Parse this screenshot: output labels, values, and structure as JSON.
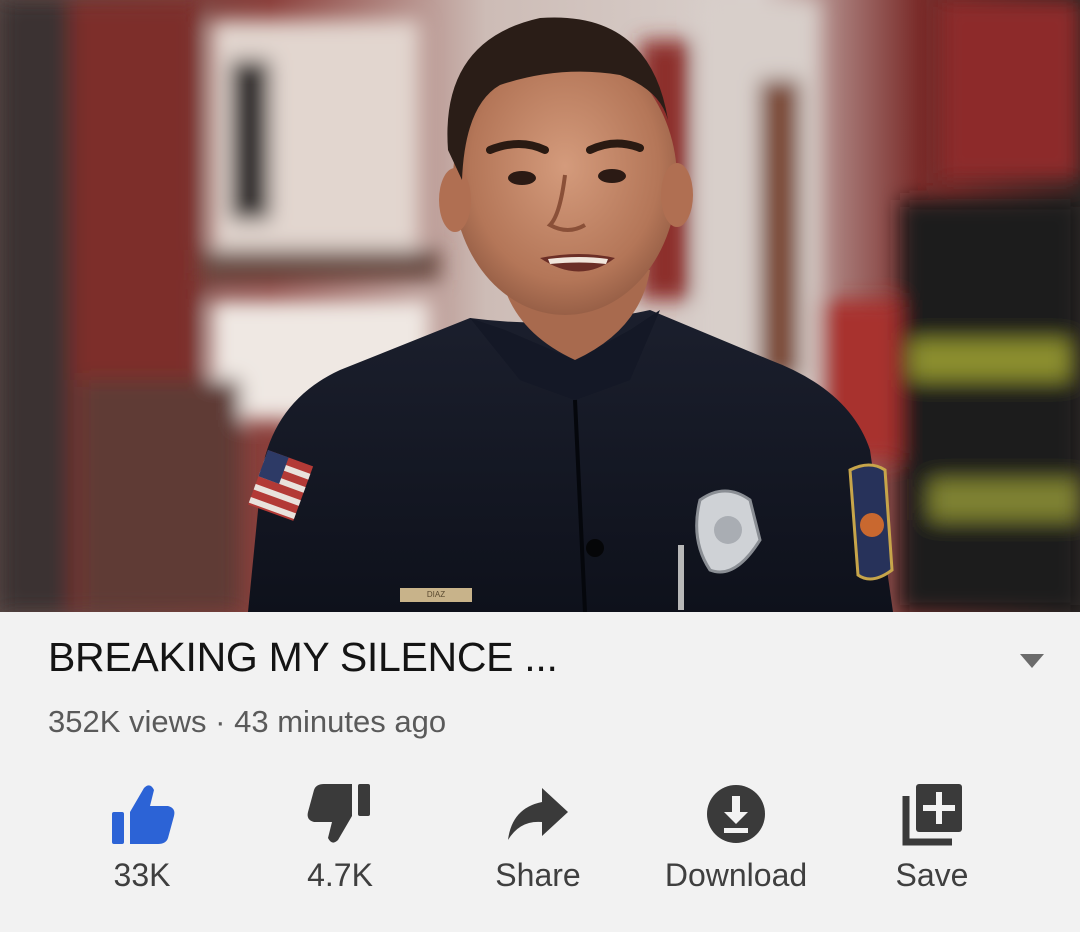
{
  "video": {
    "description_icon": "firefighter-portrait-image"
  },
  "details": {
    "title": "BREAKING MY SILENCE ...",
    "views": "352K views",
    "separator": "·",
    "uploaded": "43 minutes ago",
    "expand_icon": "chevron-down-icon"
  },
  "actions": {
    "like": {
      "label": "33K",
      "icon": "thumbs-up-icon",
      "color": "#2c63d6"
    },
    "dislike": {
      "label": "4.7K",
      "icon": "thumbs-down-icon",
      "color": "#3a3a3a"
    },
    "share": {
      "label": "Share",
      "icon": "share-arrow-icon",
      "color": "#3a3a3a"
    },
    "download": {
      "label": "Download",
      "icon": "download-icon",
      "color": "#3a3a3a"
    },
    "save": {
      "label": "Save",
      "icon": "add-to-playlist-icon",
      "color": "#3a3a3a"
    }
  },
  "badge_text": "DIAZ"
}
